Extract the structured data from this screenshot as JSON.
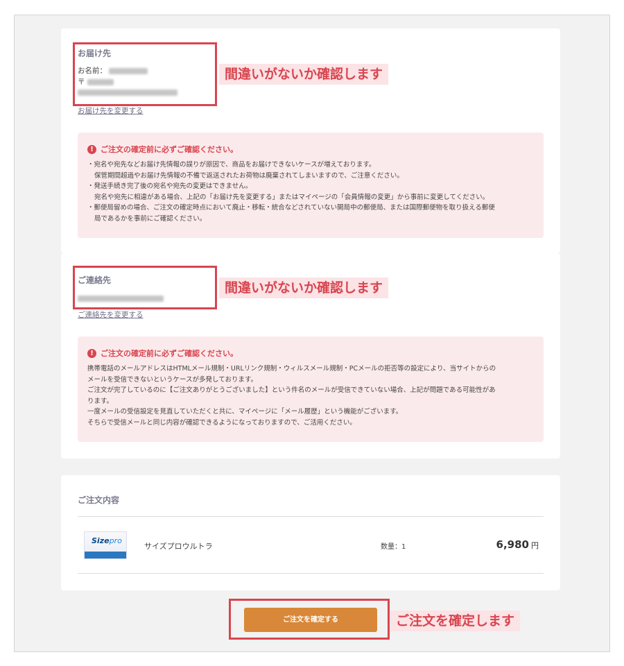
{
  "delivery": {
    "title": "お届け先",
    "name_label": "お名前：",
    "postal_mark": "〒",
    "change_link": "お届け先を変更する"
  },
  "contact": {
    "title": "ご連絡先",
    "change_link": "ご連絡先を変更する"
  },
  "callouts": {
    "check1": "間違いがないか確認します",
    "check2": "間違いがないか確認します",
    "confirm": "ご注文を確定します"
  },
  "notice1": {
    "heading": "ご注文の確定前に必ずご確認ください。",
    "lines": [
      "・宛名や宛先などお届け先情報の誤りが原因で、商品をお届けできないケースが増えております。",
      "保管期間超過やお届け先情報の不備で返送されたお荷物は廃棄されてしまいますので、ご注意ください。",
      "・発送手続き完了後の宛名や宛先の変更はできません。",
      "宛名や宛先に相違がある場合、上記の「お届け先を変更する」またはマイページの「会員情報の変更」から事前に変更してください。",
      "・郵便局留めの場合、ご注文の確定時点において廃止・移転・統合などされていない開局中の郵便局、または国際郵便物を取り扱える郵便",
      "局であるかを事前にご確認ください。"
    ]
  },
  "notice2": {
    "heading": "ご注文の確定前に必ずご確認ください。",
    "lines": [
      "携帯電話のメールアドレスはHTMLメール規制・URLリンク規制・ウィルスメール規制・PCメールの拒否等の設定により、当サイトからの",
      "メールを受信できないというケースが多発しております。",
      "ご注文が完了しているのに【ご注文ありがとうございました】という件名のメールが受信できていない場合、上記が問題である可能性があ",
      "ります。",
      "一度メールの受信設定を見直していただくと共に、マイページに「メール履歴」という機能がございます。",
      "そちらで受信メールと同じ内容が確認できるようになっておりますので、ご活用ください。"
    ]
  },
  "order": {
    "title": "ご注文内容",
    "product_name": "サイズプロウルトラ",
    "product_brand_a": "Size",
    "product_brand_b": "pro",
    "quantity": "数量：1",
    "price": "6,980",
    "currency": "円"
  },
  "confirm_button": "ご注文を確定する",
  "colors": {
    "accent_red": "#d8454f",
    "button_orange": "#d88838",
    "notice_bg": "#fbeaec"
  }
}
